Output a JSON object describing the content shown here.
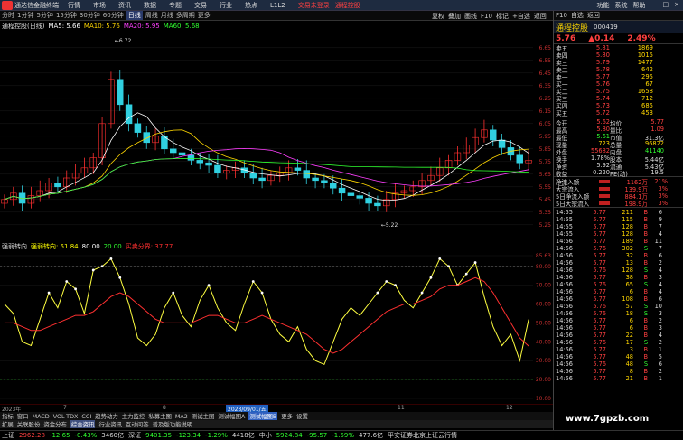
{
  "menubar": {
    "app_title": "通达信金融终端",
    "items": [
      "行情",
      "市场",
      "资讯",
      "数据",
      "专题",
      "交易",
      "行业",
      "热点",
      "L1L2"
    ],
    "promo": [
      "交易未登录",
      "通程控股"
    ],
    "right": [
      "功能",
      "系统",
      "帮助",
      "—",
      "□",
      "×"
    ]
  },
  "toolbar": {
    "periods": [
      "分时",
      "1分钟",
      "5分钟",
      "15分钟",
      "30分钟",
      "60分钟",
      "日线",
      "周线",
      "月线",
      "多周期",
      "更多"
    ],
    "active_index": 6,
    "right": [
      "复权",
      "叠加",
      "画线",
      "F10",
      "标记",
      "+自选",
      "返回"
    ]
  },
  "info_line": {
    "stock": "通程控股(日线)",
    "ma": [
      {
        "label": "MA5: 5.66",
        "color": "#ffffff"
      },
      {
        "label": "MA10: 5.76",
        "color": "#ffd700"
      },
      {
        "label": "MA20: 5.95",
        "color": "#ff40ff"
      },
      {
        "label": "MA60: 5.68",
        "color": "#30ff30"
      }
    ]
  },
  "price_axis": [
    "6.65",
    "6.55",
    "6.45",
    "6.35",
    "6.25",
    "6.15",
    "6.05",
    "5.95",
    "5.85",
    "5.75",
    "5.65",
    "5.55",
    "5.45",
    "5.35",
    "5.25"
  ],
  "main_annotations": {
    "high": "6.72",
    "low": "5.22"
  },
  "sub_header": {
    "name": "强弱转向",
    "items": [
      {
        "label": "强弱转向: 51.84",
        "color": "#ffff00"
      },
      {
        "label": "80.00",
        "color": "#ffffff"
      },
      {
        "label": "20.00",
        "color": "#30ff30"
      },
      {
        "label": "买卖分界: 37.77",
        "color": "#ff3030"
      }
    ]
  },
  "sub_axis": [
    "85.63",
    "80.00",
    "70.00",
    "60.00",
    "50.00",
    "40.00",
    "30.00",
    "20.00",
    "10.00"
  ],
  "date_axis": {
    "labels": [
      "2023年",
      "7",
      "8",
      "2023/09/01/五",
      "11",
      "12"
    ],
    "highlight_index": 3
  },
  "indicator_tabs": [
    "指标",
    "窗口",
    "MACD",
    "VOL-TDX",
    "CCI",
    "趋势动力",
    "主力监控",
    "私募主图",
    "MA2",
    "测试主图",
    "测试幅图A",
    "测试幅图B",
    "更多",
    "设置"
  ],
  "bottom_tabs": [
    "扩展",
    "关联股份",
    "资金分布",
    "综合资讯",
    "行业资讯",
    "互动问答",
    "普及版功能说明"
  ],
  "status_bar": [
    {
      "text": "上证",
      "cls": "wh"
    },
    {
      "text": "2962.28",
      "cls": "up"
    },
    {
      "text": "-12.65",
      "cls": "dn"
    },
    {
      "text": "-0.43%",
      "cls": "dn"
    },
    {
      "text": "3460亿",
      "cls": "wh"
    },
    {
      "text": "深证",
      "cls": "wh"
    },
    {
      "text": "9401.35",
      "cls": "dn"
    },
    {
      "text": "-123.34",
      "cls": "dn"
    },
    {
      "text": "-1.29%",
      "cls": "dn"
    },
    {
      "text": "4418亿",
      "cls": "wh"
    },
    {
      "text": "中小",
      "cls": "wh"
    },
    {
      "text": "5924.84",
      "cls": "dn"
    },
    {
      "text": "-95.57",
      "cls": "dn"
    },
    {
      "text": "-1.59%",
      "cls": "dn"
    },
    {
      "text": "477.6亿",
      "cls": "wh"
    },
    {
      "text": "平安证券北京上证云行情",
      "cls": "wh"
    }
  ],
  "right_panel": {
    "toolbar": [
      "F10",
      "自选",
      "返回"
    ],
    "name": "通程控股",
    "code": "000419",
    "price": "5.76",
    "change": "▲0.14",
    "change_pct": "2.49%",
    "asks": [
      {
        "label": "卖五",
        "price": "5.81",
        "vol": "1869"
      },
      {
        "label": "卖四",
        "price": "5.80",
        "vol": "1015"
      },
      {
        "label": "卖三",
        "price": "5.79",
        "vol": "1477"
      },
      {
        "label": "卖二",
        "price": "5.78",
        "vol": "642"
      },
      {
        "label": "卖一",
        "price": "5.77",
        "vol": "295"
      }
    ],
    "bids": [
      {
        "label": "买一",
        "price": "5.76",
        "vol": "67"
      },
      {
        "label": "买二",
        "price": "5.75",
        "vol": "1658"
      },
      {
        "label": "买三",
        "price": "5.74",
        "vol": "712"
      },
      {
        "label": "买四",
        "price": "5.73",
        "vol": "685"
      },
      {
        "label": "买五",
        "price": "5.72",
        "vol": "453"
      }
    ],
    "stats": [
      [
        {
          "t": "今开",
          "c": "white"
        },
        {
          "t": "5.62",
          "c": "red"
        },
        {
          "t": "均价",
          "c": "white"
        },
        {
          "t": "5.77",
          "c": "red"
        }
      ],
      [
        {
          "t": "最高",
          "c": "white"
        },
        {
          "t": "5.80",
          "c": "red"
        },
        {
          "t": "量比",
          "c": "white"
        },
        {
          "t": "1.09",
          "c": "red"
        }
      ],
      [
        {
          "t": "最低",
          "c": "white"
        },
        {
          "t": "5.61",
          "c": "green"
        },
        {
          "t": "市值",
          "c": "white"
        },
        {
          "t": "31.3亿",
          "c": "white"
        }
      ],
      [
        {
          "t": "现量",
          "c": "white"
        },
        {
          "t": "723",
          "c": "yellow"
        },
        {
          "t": "总量",
          "c": "white"
        },
        {
          "t": "96822",
          "c": "yellow"
        }
      ],
      [
        {
          "t": "外盘",
          "c": "white"
        },
        {
          "t": "55682",
          "c": "red"
        },
        {
          "t": "内盘",
          "c": "white"
        },
        {
          "t": "41140",
          "c": "green"
        }
      ],
      [
        {
          "t": "换手",
          "c": "white"
        },
        {
          "t": "1.78%",
          "c": "white"
        },
        {
          "t": "股本",
          "c": "white"
        },
        {
          "t": "5.44亿",
          "c": "white"
        }
      ],
      [
        {
          "t": "净资",
          "c": "white"
        },
        {
          "t": "5.92",
          "c": "white"
        },
        {
          "t": "流通",
          "c": "white"
        },
        {
          "t": "5.43亿",
          "c": "white"
        }
      ],
      [
        {
          "t": "收益(三)",
          "c": "white"
        },
        {
          "t": "0.220",
          "c": "white"
        },
        {
          "t": "PE(动)",
          "c": "white"
        },
        {
          "t": "19.5",
          "c": "white"
        }
      ]
    ],
    "flows": [
      {
        "label": "净流入额",
        "val": "1162万",
        "pct": "21%"
      },
      {
        "label": "大宗流入",
        "val": "139.9万",
        "pct": "3%"
      },
      {
        "label": "5日净流入额",
        "val": "884.1万",
        "pct": "3%"
      },
      {
        "label": "5日大宗流入",
        "val": "198.9万",
        "pct": "3%"
      }
    ],
    "ticks": [
      {
        "t": "14:55",
        "p": "5.77",
        "q": "211",
        "s": "B",
        "n": "6"
      },
      {
        "t": "14:55",
        "p": "5.77",
        "q": "115",
        "s": "B",
        "n": "9"
      },
      {
        "t": "14:55",
        "p": "5.77",
        "q": "128",
        "s": "B",
        "n": "7"
      },
      {
        "t": "14:55",
        "p": "5.77",
        "q": "128",
        "s": "B",
        "n": "4"
      },
      {
        "t": "14:56",
        "p": "5.77",
        "q": "189",
        "s": "B",
        "n": "11"
      },
      {
        "t": "14:56",
        "p": "5.76",
        "q": "302",
        "s": "S",
        "n": "7"
      },
      {
        "t": "14:56",
        "p": "5.77",
        "q": "32",
        "s": "B",
        "n": "6"
      },
      {
        "t": "14:56",
        "p": "5.77",
        "q": "13",
        "s": "B",
        "n": "2"
      },
      {
        "t": "14:56",
        "p": "5.76",
        "q": "128",
        "s": "S",
        "n": "4"
      },
      {
        "t": "14:56",
        "p": "5.77",
        "q": "38",
        "s": "B",
        "n": "3"
      },
      {
        "t": "14:56",
        "p": "5.76",
        "q": "65",
        "s": "S",
        "n": "4"
      },
      {
        "t": "14:56",
        "p": "5.77",
        "q": "6",
        "s": "B",
        "n": "4"
      },
      {
        "t": "14:56",
        "p": "5.77",
        "q": "108",
        "s": "B",
        "n": "6"
      },
      {
        "t": "14:56",
        "p": "5.76",
        "q": "57",
        "s": "S",
        "n": "10"
      },
      {
        "t": "14:56",
        "p": "5.76",
        "q": "18",
        "s": "S",
        "n": "3"
      },
      {
        "t": "14:56",
        "p": "5.77",
        "q": "6",
        "s": "B",
        "n": "2"
      },
      {
        "t": "14:56",
        "p": "5.77",
        "q": "6",
        "s": "B",
        "n": "3"
      },
      {
        "t": "14:56",
        "p": "5.77",
        "q": "22",
        "s": "B",
        "n": "4"
      },
      {
        "t": "14:56",
        "p": "5.76",
        "q": "17",
        "s": "S",
        "n": "2"
      },
      {
        "t": "14:56",
        "p": "5.77",
        "q": "3",
        "s": "B",
        "n": "1"
      },
      {
        "t": "14:56",
        "p": "5.77",
        "q": "48",
        "s": "B",
        "n": "5"
      },
      {
        "t": "14:56",
        "p": "5.76",
        "q": "48",
        "s": "S",
        "n": "6"
      },
      {
        "t": "14:56",
        "p": "5.77",
        "q": "8",
        "s": "B",
        "n": "2"
      },
      {
        "t": "14:56",
        "p": "5.77",
        "q": "21",
        "s": "B",
        "n": "1"
      }
    ]
  },
  "chart_data": [
    {
      "type": "candlestick",
      "title": "通程控股(日线)",
      "ylim": [
        5.22,
        6.72
      ],
      "closes": [
        5.45,
        5.5,
        5.42,
        5.48,
        5.52,
        5.58,
        5.55,
        5.62,
        5.66,
        5.7,
        5.78,
        6.05,
        6.4,
        6.2,
        6.05,
        5.98,
        5.9,
        5.95,
        5.85,
        5.82,
        5.8,
        5.76,
        5.74,
        5.72,
        5.66,
        5.68,
        5.7,
        5.66,
        5.62,
        5.6,
        5.64,
        5.66,
        5.7,
        5.68,
        5.62,
        5.6,
        5.58,
        5.54,
        5.5,
        5.48,
        5.46,
        5.42,
        5.4,
        5.45,
        5.5,
        5.52,
        5.55,
        5.6,
        5.64,
        5.7,
        5.76,
        5.82,
        5.88,
        5.94,
        6.0,
        5.92,
        5.86,
        5.8,
        5.74,
        5.76
      ],
      "ma5": 5.66,
      "ma10": 5.76,
      "ma20": 5.95,
      "ma60": 5.68,
      "annotations": {
        "high": 6.72,
        "low": 5.22
      }
    },
    {
      "type": "line",
      "title": "强弱转向",
      "ylim": [
        10,
        85.63
      ],
      "series": [
        {
          "name": "强弱转向",
          "values": [
            60,
            55,
            40,
            38,
            52,
            66,
            58,
            72,
            68,
            55,
            78,
            80,
            84,
            74,
            60,
            42,
            38,
            44,
            58,
            66,
            54,
            48,
            62,
            70,
            58,
            50,
            46,
            60,
            72,
            66,
            52,
            44,
            40,
            48,
            36,
            30,
            28,
            40,
            52,
            58,
            54,
            60,
            66,
            72,
            70,
            62,
            58,
            66,
            74,
            84,
            80,
            70,
            76,
            82,
            64,
            48,
            38,
            44,
            30,
            51.84
          ]
        },
        {
          "name": "买卖分界",
          "values": [
            50,
            50,
            48,
            46,
            46,
            48,
            50,
            52,
            54,
            54,
            56,
            60,
            64,
            66,
            64,
            60,
            56,
            52,
            50,
            50,
            50,
            50,
            52,
            54,
            54,
            52,
            50,
            50,
            52,
            54,
            52,
            50,
            48,
            46,
            44,
            40,
            36,
            34,
            36,
            40,
            44,
            48,
            52,
            56,
            58,
            60,
            60,
            62,
            64,
            68,
            70,
            70,
            72,
            74,
            72,
            66,
            58,
            50,
            42,
            37.77
          ]
        }
      ],
      "reference_lines": [
        80,
        20
      ]
    }
  ]
}
